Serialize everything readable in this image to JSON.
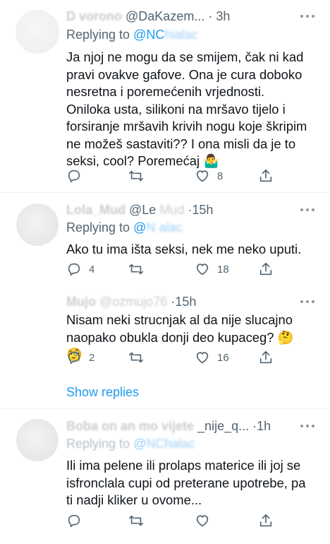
{
  "tweets": [
    {
      "name": "D          vorono",
      "handle": "@DaKazem...",
      "time": "3h",
      "replying_prefix": "Replying to ",
      "replying_at": "@NC",
      "replying_blur": "hialac",
      "text": "Ja njoj ne mogu da se smijem, čak ni kad pravi ovakve gafove. Ona je cura doboko nesretna i poremećenih vrjednosti. Oniloka usta, silikoni na mršavo tijelo i forsiranje mršavih krivih nogu koje škripim ne možeš sastaviti?? I ona misli da je to seksi, cool? Poremećaj",
      "emoji": "🤷‍♂️",
      "likes": "8",
      "replies": "",
      "retweets": ""
    },
    {
      "name": "Lola_Mud",
      "handle_prefix": "@Le",
      "handle_blur": "     Mud",
      "time": "15h",
      "replying_prefix": "Replying to ",
      "replying_at": "@",
      "replying_blur": "N     alac",
      "text": "Ako tu ima išta seksi, nek me neko uputi.",
      "likes": "18",
      "replies": "4",
      "retweets": ""
    },
    {
      "name": "Mujo",
      "handle_blur": "@ozmujo76",
      "time": "15h",
      "text": "Nisam neki strucnjak al da nije slucajno naopako obukla donji deo kupaceg?",
      "emoji_1": "🤔",
      "emoji_2": "🧐",
      "likes": "16",
      "replies": "2",
      "retweets": ""
    }
  ],
  "show_replies": "Show replies",
  "last": {
    "name": "Boba on an mo vijete",
    "handle": "_nije_q...",
    "time": "1h",
    "replying_prefix": "Replying to ",
    "replying_at": "@",
    "replying_blur": "NChalac",
    "text": "Ili ima pelene ili prolaps materice ili joj se isfronclala cupi od preterane upotrebe, pa ti nadji kliker u ovome..."
  },
  "icons": [
    "reply-icon",
    "retweet-icon",
    "like-icon",
    "share-icon",
    "more-icon"
  ],
  "colors": {
    "accent": "#1d9bf0",
    "muted": "#536471",
    "text": "#0f1419",
    "separator": "#eff3f4"
  }
}
